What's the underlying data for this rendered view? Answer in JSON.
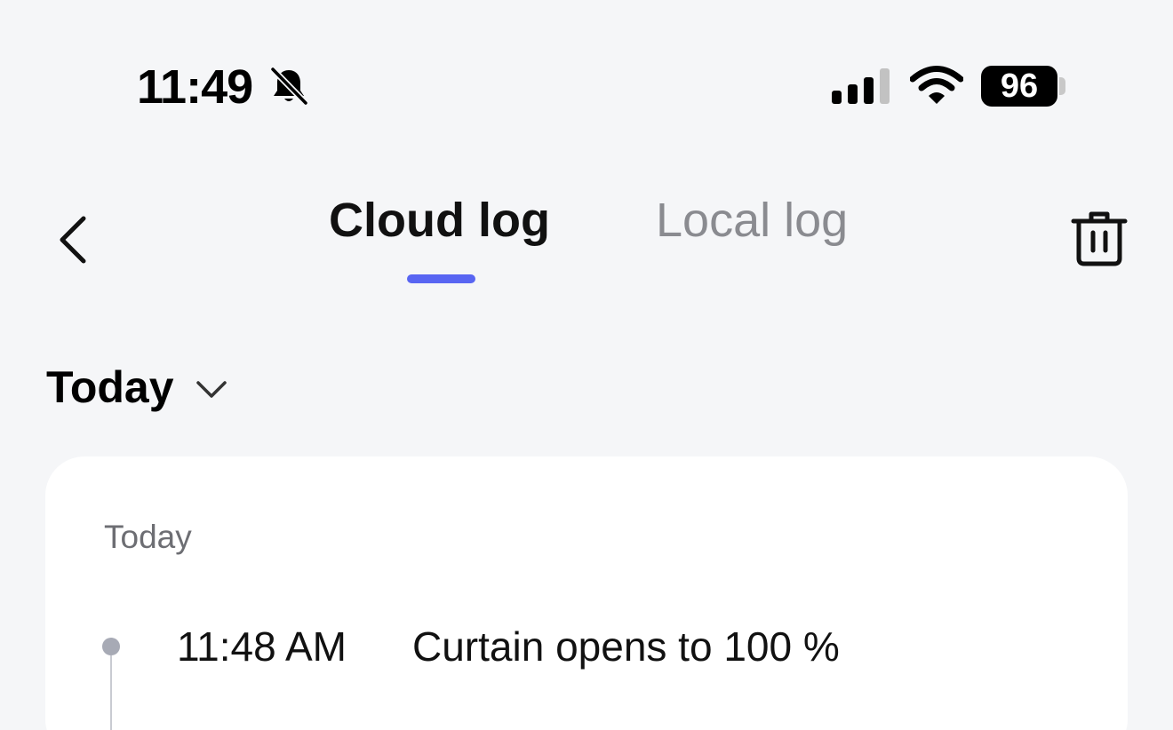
{
  "status_bar": {
    "time": "11:49",
    "battery": "96",
    "icons": [
      "bell-slash-icon",
      "signal-icon",
      "wifi-icon",
      "battery-icon"
    ]
  },
  "header": {
    "tabs": [
      {
        "label": "Cloud log",
        "active": true
      },
      {
        "label": "Local log",
        "active": false
      }
    ],
    "accent_color": "#5865f2"
  },
  "filter": {
    "selected": "Today"
  },
  "log": {
    "group_label": "Today",
    "entries": [
      {
        "time": "11:48 AM",
        "text": "Curtain opens to 100 %"
      }
    ]
  }
}
